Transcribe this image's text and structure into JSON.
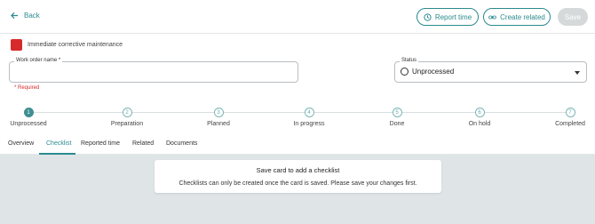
{
  "header": {
    "back_label": "Back",
    "report_time_label": "Report time",
    "create_related_label": "Create related",
    "save_label": "Save"
  },
  "category": {
    "label": "Immediate corrective maintenance",
    "color": "#d62b2b"
  },
  "form": {
    "work_order_label": "Work order name *",
    "work_order_value": "",
    "required_text": "* Required",
    "status_label": "Status",
    "status_value": "Unprocessed"
  },
  "steps": [
    {
      "number": "1",
      "label": "Unprocessed",
      "active": true
    },
    {
      "number": "2",
      "label": "Preparation",
      "active": false
    },
    {
      "number": "3",
      "label": "Planned",
      "active": false
    },
    {
      "number": "4",
      "label": "In progress",
      "active": false
    },
    {
      "number": "5",
      "label": "Done",
      "active": false
    },
    {
      "number": "6",
      "label": "On hold",
      "active": false
    },
    {
      "number": "7",
      "label": "Completed",
      "active": false
    }
  ],
  "tabs": [
    {
      "label": "Overview",
      "active": false
    },
    {
      "label": "Checklist",
      "active": true
    },
    {
      "label": "Reported time",
      "active": false
    },
    {
      "label": "Related",
      "active": false
    },
    {
      "label": "Documents",
      "active": false
    }
  ],
  "notice": {
    "title": "Save card to add a checklist",
    "body": "Checklists can only be created once the card is saved. Please save your changes first."
  },
  "colors": {
    "accent": "#2a8a8e",
    "required": "#d62b2b",
    "content_bg": "#dfe5e7"
  }
}
